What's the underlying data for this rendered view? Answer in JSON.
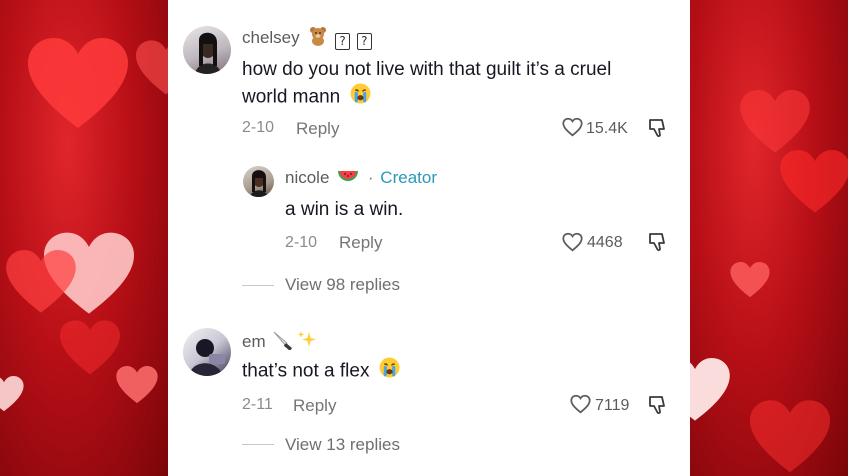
{
  "comments": [
    {
      "username": "chelsey",
      "name_emoji": "teddy-bear",
      "name_unknown_glyphs": [
        "?",
        "?"
      ],
      "text_line1": "how do you not live with that guilt it’s a cruel",
      "text_line2": "world mann",
      "text_emoji": "crying-face",
      "date": "2-10",
      "reply_label": "Reply",
      "likes": "15.4K",
      "replies": [
        {
          "username": "nicole",
          "name_emoji": "watermelon",
          "separator": "·",
          "creator_label": "Creator",
          "text": "a win is a win.",
          "date": "2-10",
          "reply_label": "Reply",
          "likes": "4468"
        }
      ],
      "view_replies": "View 98 replies"
    },
    {
      "username": "em",
      "name_emoji": [
        "knife",
        "sparkles"
      ],
      "text": "that’s not a flex",
      "text_emoji": "crying-face",
      "date": "2-11",
      "reply_label": "Reply",
      "likes": "7119",
      "view_replies": "View 13 replies"
    }
  ],
  "colors": {
    "background_red": "#b80f17",
    "creator_blue": "#2b9ab8",
    "text_dark": "#161823",
    "text_muted": "#8a8b91"
  }
}
